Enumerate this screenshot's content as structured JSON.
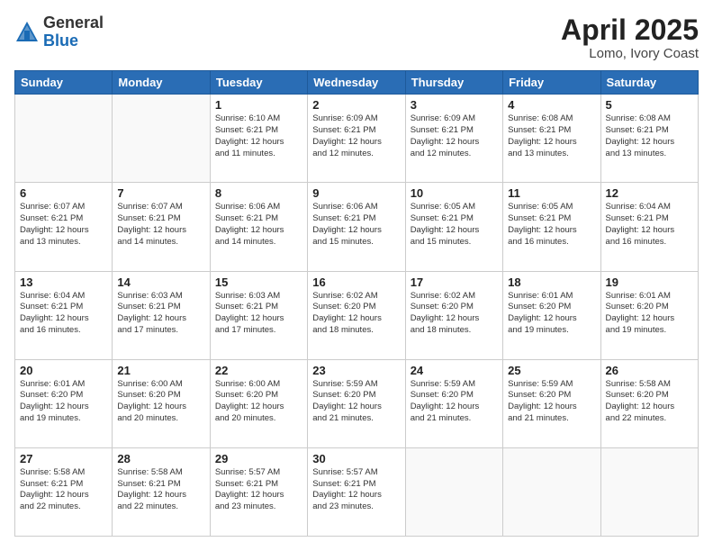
{
  "header": {
    "logo_general": "General",
    "logo_blue": "Blue",
    "title": "April 2025",
    "location": "Lomo, Ivory Coast"
  },
  "days_of_week": [
    "Sunday",
    "Monday",
    "Tuesday",
    "Wednesday",
    "Thursday",
    "Friday",
    "Saturday"
  ],
  "weeks": [
    [
      {
        "num": "",
        "info": ""
      },
      {
        "num": "",
        "info": ""
      },
      {
        "num": "1",
        "info": "Sunrise: 6:10 AM\nSunset: 6:21 PM\nDaylight: 12 hours\nand 11 minutes."
      },
      {
        "num": "2",
        "info": "Sunrise: 6:09 AM\nSunset: 6:21 PM\nDaylight: 12 hours\nand 12 minutes."
      },
      {
        "num": "3",
        "info": "Sunrise: 6:09 AM\nSunset: 6:21 PM\nDaylight: 12 hours\nand 12 minutes."
      },
      {
        "num": "4",
        "info": "Sunrise: 6:08 AM\nSunset: 6:21 PM\nDaylight: 12 hours\nand 13 minutes."
      },
      {
        "num": "5",
        "info": "Sunrise: 6:08 AM\nSunset: 6:21 PM\nDaylight: 12 hours\nand 13 minutes."
      }
    ],
    [
      {
        "num": "6",
        "info": "Sunrise: 6:07 AM\nSunset: 6:21 PM\nDaylight: 12 hours\nand 13 minutes."
      },
      {
        "num": "7",
        "info": "Sunrise: 6:07 AM\nSunset: 6:21 PM\nDaylight: 12 hours\nand 14 minutes."
      },
      {
        "num": "8",
        "info": "Sunrise: 6:06 AM\nSunset: 6:21 PM\nDaylight: 12 hours\nand 14 minutes."
      },
      {
        "num": "9",
        "info": "Sunrise: 6:06 AM\nSunset: 6:21 PM\nDaylight: 12 hours\nand 15 minutes."
      },
      {
        "num": "10",
        "info": "Sunrise: 6:05 AM\nSunset: 6:21 PM\nDaylight: 12 hours\nand 15 minutes."
      },
      {
        "num": "11",
        "info": "Sunrise: 6:05 AM\nSunset: 6:21 PM\nDaylight: 12 hours\nand 16 minutes."
      },
      {
        "num": "12",
        "info": "Sunrise: 6:04 AM\nSunset: 6:21 PM\nDaylight: 12 hours\nand 16 minutes."
      }
    ],
    [
      {
        "num": "13",
        "info": "Sunrise: 6:04 AM\nSunset: 6:21 PM\nDaylight: 12 hours\nand 16 minutes."
      },
      {
        "num": "14",
        "info": "Sunrise: 6:03 AM\nSunset: 6:21 PM\nDaylight: 12 hours\nand 17 minutes."
      },
      {
        "num": "15",
        "info": "Sunrise: 6:03 AM\nSunset: 6:21 PM\nDaylight: 12 hours\nand 17 minutes."
      },
      {
        "num": "16",
        "info": "Sunrise: 6:02 AM\nSunset: 6:20 PM\nDaylight: 12 hours\nand 18 minutes."
      },
      {
        "num": "17",
        "info": "Sunrise: 6:02 AM\nSunset: 6:20 PM\nDaylight: 12 hours\nand 18 minutes."
      },
      {
        "num": "18",
        "info": "Sunrise: 6:01 AM\nSunset: 6:20 PM\nDaylight: 12 hours\nand 19 minutes."
      },
      {
        "num": "19",
        "info": "Sunrise: 6:01 AM\nSunset: 6:20 PM\nDaylight: 12 hours\nand 19 minutes."
      }
    ],
    [
      {
        "num": "20",
        "info": "Sunrise: 6:01 AM\nSunset: 6:20 PM\nDaylight: 12 hours\nand 19 minutes."
      },
      {
        "num": "21",
        "info": "Sunrise: 6:00 AM\nSunset: 6:20 PM\nDaylight: 12 hours\nand 20 minutes."
      },
      {
        "num": "22",
        "info": "Sunrise: 6:00 AM\nSunset: 6:20 PM\nDaylight: 12 hours\nand 20 minutes."
      },
      {
        "num": "23",
        "info": "Sunrise: 5:59 AM\nSunset: 6:20 PM\nDaylight: 12 hours\nand 21 minutes."
      },
      {
        "num": "24",
        "info": "Sunrise: 5:59 AM\nSunset: 6:20 PM\nDaylight: 12 hours\nand 21 minutes."
      },
      {
        "num": "25",
        "info": "Sunrise: 5:59 AM\nSunset: 6:20 PM\nDaylight: 12 hours\nand 21 minutes."
      },
      {
        "num": "26",
        "info": "Sunrise: 5:58 AM\nSunset: 6:20 PM\nDaylight: 12 hours\nand 22 minutes."
      }
    ],
    [
      {
        "num": "27",
        "info": "Sunrise: 5:58 AM\nSunset: 6:21 PM\nDaylight: 12 hours\nand 22 minutes."
      },
      {
        "num": "28",
        "info": "Sunrise: 5:58 AM\nSunset: 6:21 PM\nDaylight: 12 hours\nand 22 minutes."
      },
      {
        "num": "29",
        "info": "Sunrise: 5:57 AM\nSunset: 6:21 PM\nDaylight: 12 hours\nand 23 minutes."
      },
      {
        "num": "30",
        "info": "Sunrise: 5:57 AM\nSunset: 6:21 PM\nDaylight: 12 hours\nand 23 minutes."
      },
      {
        "num": "",
        "info": ""
      },
      {
        "num": "",
        "info": ""
      },
      {
        "num": "",
        "info": ""
      }
    ]
  ]
}
